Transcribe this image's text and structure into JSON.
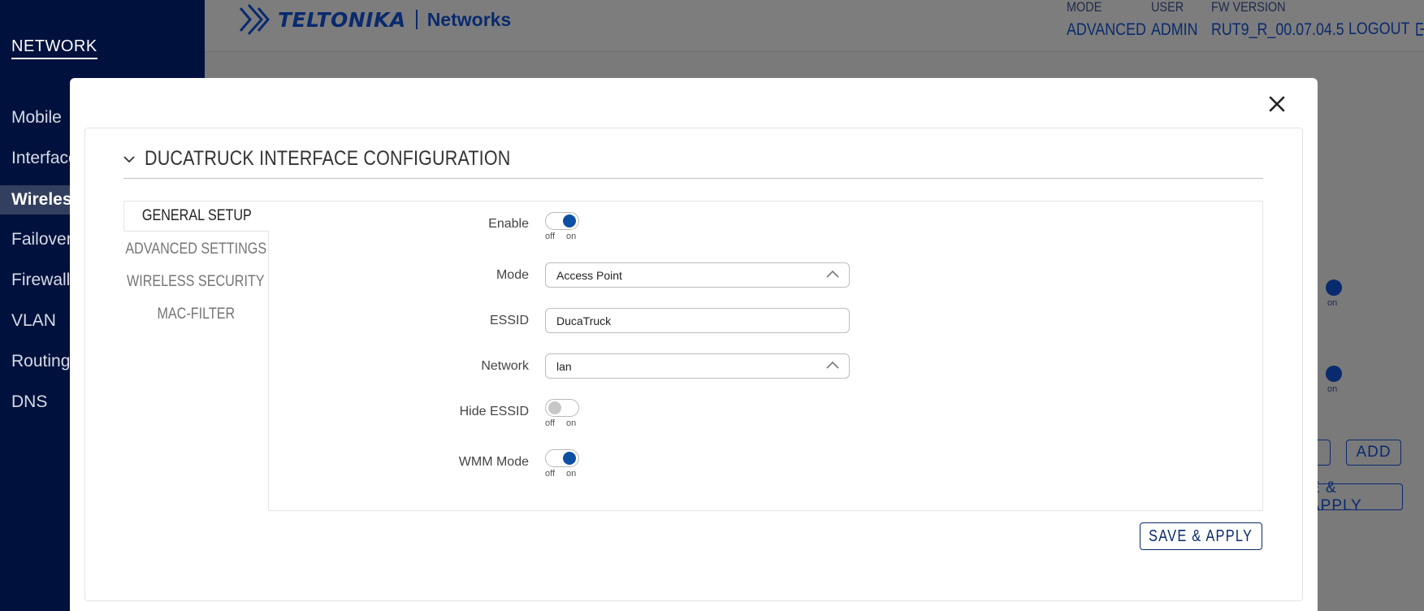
{
  "sidebar": {
    "section": "NETWORK",
    "items": [
      {
        "label": "Mobile"
      },
      {
        "label": "Interfaces"
      },
      {
        "label": "Wireless"
      },
      {
        "label": "Failover"
      },
      {
        "label": "Firewall"
      },
      {
        "label": "VLAN"
      },
      {
        "label": "Routing"
      },
      {
        "label": "DNS"
      }
    ]
  },
  "header": {
    "brand": "TELTONIKA",
    "brand_suffix": "Networks",
    "mode_label": "MODE",
    "mode_value": "ADVANCED",
    "user_label": "USER",
    "user_value": "ADMIN",
    "fw_label": "FW VERSION",
    "fw_value": "RUT9_R_00.07.04.5",
    "logout": "LOGOUT"
  },
  "background": {
    "toggle_on_1": "on",
    "toggle_on_2": "on",
    "add_button": "ADD",
    "apply_button_partial": "E & APPLY"
  },
  "modal": {
    "section_title": "DUCATRUCK INTERFACE CONFIGURATION",
    "tabs": [
      {
        "label": "GENERAL SETUP",
        "active": true
      },
      {
        "label": "ADVANCED SETTINGS",
        "active": false
      },
      {
        "label": "WIRELESS SECURITY",
        "active": false
      },
      {
        "label": "MAC-FILTER",
        "active": false
      }
    ],
    "fields": {
      "enable": {
        "label": "Enable",
        "state": "on",
        "off": "off",
        "on": "on"
      },
      "mode": {
        "label": "Mode",
        "value": "Access Point"
      },
      "essid": {
        "label": "ESSID",
        "value": "DucaTruck"
      },
      "network": {
        "label": "Network",
        "value": "lan"
      },
      "hide_essid": {
        "label": "Hide ESSID",
        "state": "off",
        "off": "off",
        "on": "on"
      },
      "wmm_mode": {
        "label": "WMM Mode",
        "state": "on",
        "off": "off",
        "on": "on"
      }
    },
    "save_button": "SAVE & APPLY"
  },
  "colors": {
    "sidebar_bg": "#00113d",
    "accent": "#0d4fa3",
    "brand_blue": "#0a2a6e",
    "overlay": "#7f7f7f"
  }
}
